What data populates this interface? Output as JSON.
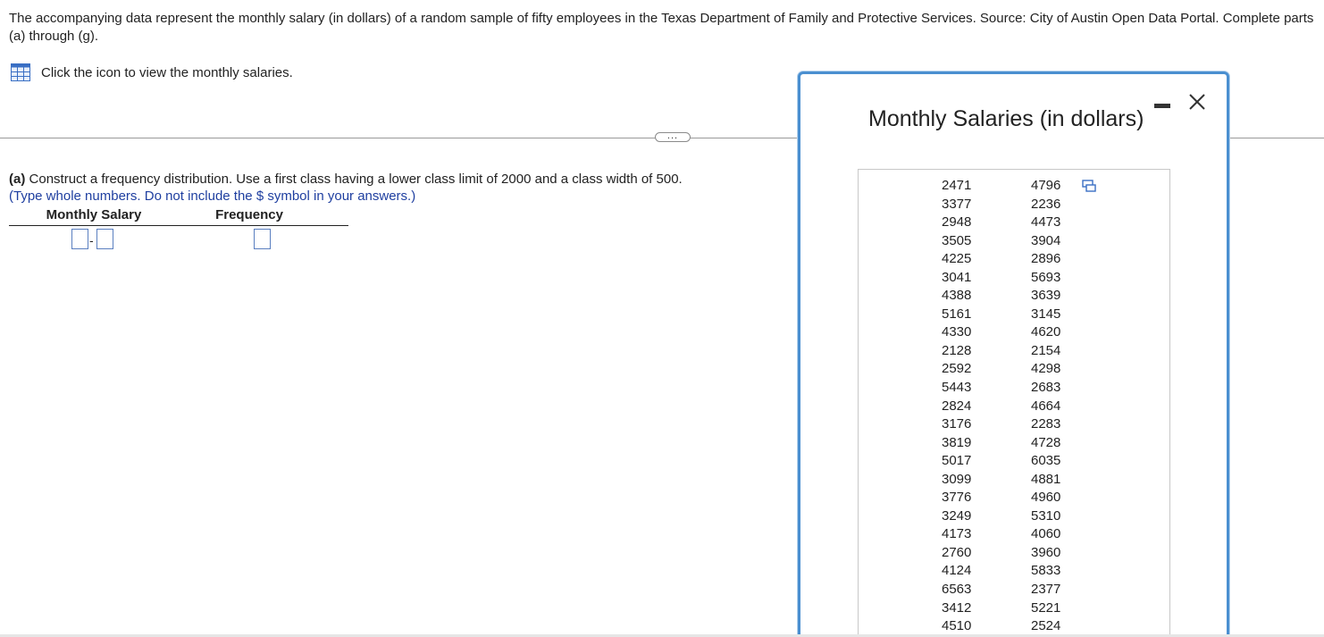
{
  "intro": {
    "text": "The accompanying data represent the monthly salary (in dollars) of a random sample of fifty employees in the Texas Department of Family and Protective Services. Source: City of Austin Open Data Portal. Complete parts (a) through (g)."
  },
  "view_link": {
    "label": "Click the icon to view the monthly salaries."
  },
  "more_button": {
    "label": "..."
  },
  "part_a": {
    "label": "(a)",
    "text": "Construct a frequency distribution. Use a first class having a lower class limit of 2000 and a class width of 500.",
    "hint": "(Type whole numbers. Do not include the $ symbol in your answers.)",
    "table": {
      "col1_header": "Monthly Salary",
      "col2_header": "Frequency",
      "dash": "-"
    }
  },
  "popup": {
    "title": "Monthly Salaries (in dollars)",
    "col1": [
      "2471",
      "3377",
      "2948",
      "3505",
      "4225",
      "3041",
      "4388",
      "5161",
      "4330",
      "2128",
      "2592",
      "5443",
      "2824",
      "3176",
      "3819",
      "5017",
      "3099",
      "3776",
      "3249",
      "4173",
      "2760",
      "4124",
      "6563",
      "3412",
      "4510"
    ],
    "col2": [
      "4796",
      "2236",
      "4473",
      "3904",
      "2896",
      "5693",
      "3639",
      "3145",
      "4620",
      "2154",
      "4298",
      "2683",
      "4664",
      "2283",
      "4728",
      "6035",
      "4881",
      "4960",
      "5310",
      "4060",
      "3960",
      "5833",
      "2377",
      "5221",
      "2524"
    ]
  },
  "colors": {
    "accent_border": "#4a8fd0",
    "hint_text": "#1f3fa0",
    "input_border": "#5a7fc0"
  }
}
